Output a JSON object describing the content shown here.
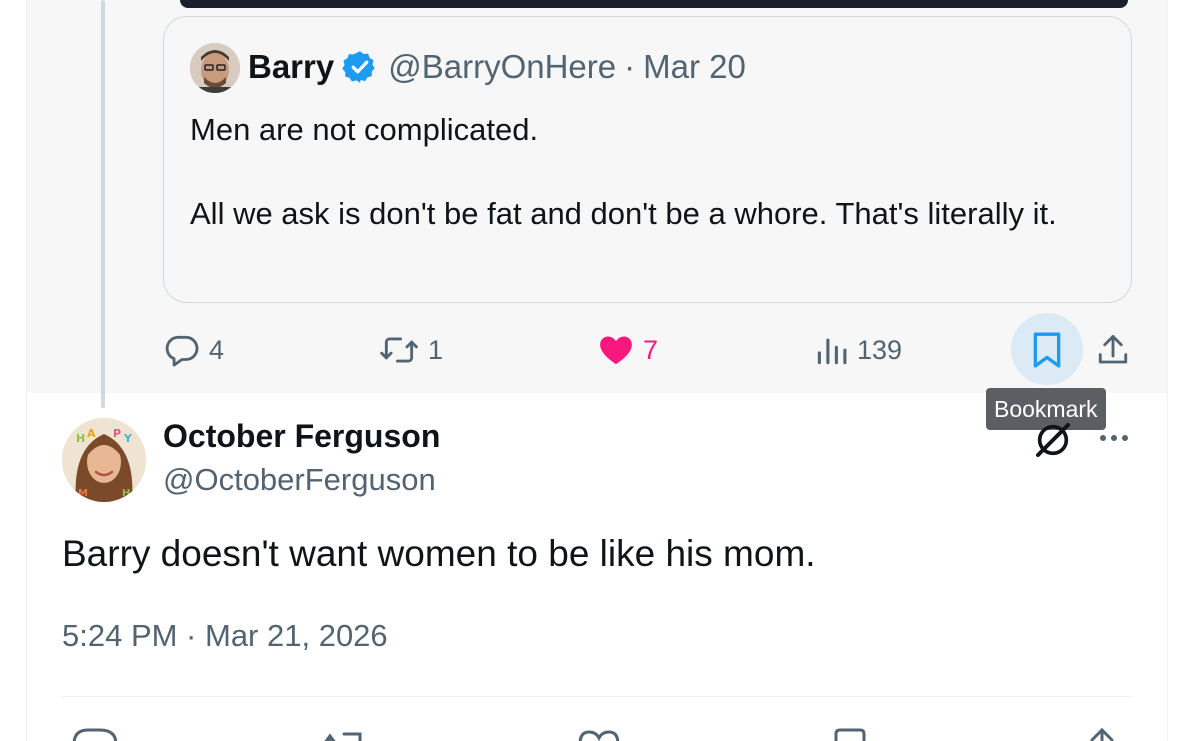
{
  "quoted_tweet": {
    "name": "Barry",
    "handle": "@BarryOnHere",
    "separator": "·",
    "date": "Mar 20",
    "text_line1": "Men are not complicated.",
    "text_line2": "All we ask is don't be fat and don't be a whore. That's literally it."
  },
  "actions": {
    "replies": "4",
    "reposts": "1",
    "likes": "7",
    "views": "139"
  },
  "tooltip": "Bookmark",
  "main_tweet": {
    "name": "October Ferguson",
    "handle": "@OctoberFerguson",
    "text": "Barry doesn't want women to be like his mom.",
    "timestamp": "5:24 PM · Mar 21, 2026"
  },
  "icons": {
    "verified": "verified-badge-icon",
    "reply": "reply-icon",
    "repost": "repost-icon",
    "like": "heart-icon",
    "views": "views-icon",
    "bookmark": "bookmark-icon",
    "share": "share-icon",
    "grok": "grok-icon",
    "more": "more-icon"
  },
  "colors": {
    "verified": "#1d9bf0",
    "like": "#f91880",
    "muted": "#536471",
    "bookmark_active": "#1d9bf0"
  }
}
